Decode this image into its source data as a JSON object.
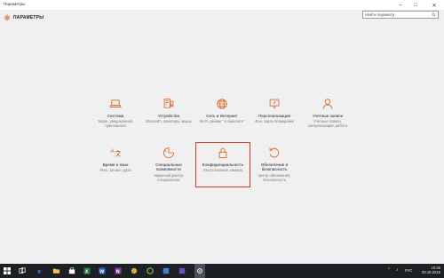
{
  "window": {
    "title": "Параметры",
    "controls": {
      "minimize": "–",
      "maximize": "□",
      "close": "✕"
    }
  },
  "header": {
    "icon": "gear-icon",
    "title": "ПАРАМЕТРЫ",
    "search_placeholder": "Найти параметр",
    "search_icon": "search-icon"
  },
  "tiles": [
    {
      "icon": "laptop-icon",
      "label": "Система",
      "desc": "Экран, уведомления, приложения"
    },
    {
      "icon": "devices-icon",
      "label": "Устройства",
      "desc": "Bluetooth, принтеры, мышь"
    },
    {
      "icon": "globe-icon",
      "label": "Сеть и Интернет",
      "desc": "Wi-Fi, режим \" в самолете\""
    },
    {
      "icon": "brush-icon",
      "label": "Персонализация",
      "desc": "Фон, экран блокировки"
    },
    {
      "icon": "person-icon",
      "label": "Учетные записи",
      "desc": "Учетные записи, синхронизация, работа"
    },
    {
      "icon": "language-icon",
      "label": "Время и язык",
      "desc": "Речь, регион, дата"
    },
    {
      "icon": "accessibility-icon",
      "label": "Специальные возможности",
      "desc": "Экранный диктор, специальные"
    },
    {
      "icon": "lock-icon",
      "label": "Конфиденциальность",
      "desc": "Расположение, камера"
    },
    {
      "icon": "update-icon",
      "label": "Обновление и безопасность",
      "desc": "Центр обновления, безопасность"
    }
  ],
  "accent_color": "#d9692a",
  "highlight_color": "#d03a1e",
  "taskbar": {
    "clock_time": "10:45",
    "clock_date": "08.10.2015",
    "language": "РУС"
  }
}
